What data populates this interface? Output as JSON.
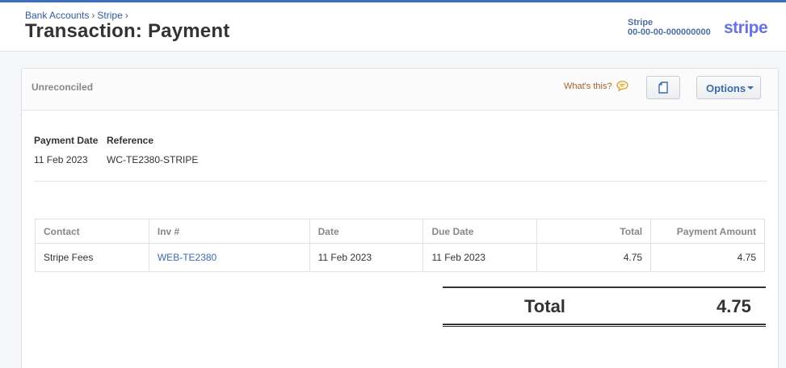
{
  "breadcrumb": {
    "item1": "Bank Accounts",
    "item2": "Stripe",
    "sep": "›"
  },
  "page_title": "Transaction: Payment",
  "account": {
    "name": "Stripe",
    "number": "00-00-00-000000000",
    "logo_text": "stripe"
  },
  "panel": {
    "status": "Unreconciled",
    "whats_this": "What's this?",
    "options_label": "Options",
    "icons": {
      "help": "speech-bubble-icon",
      "copy": "copy-icon",
      "options": "chevron-down-icon"
    }
  },
  "details": {
    "payment_date_label": "Payment Date",
    "payment_date": "11 Feb 2023",
    "reference_label": "Reference",
    "reference": "WC-TE2380-STRIPE"
  },
  "table": {
    "headers": [
      "Contact",
      "Inv #",
      "Date",
      "Due Date",
      "Total",
      "Payment Amount"
    ],
    "rows": [
      [
        "Stripe Fees",
        "WEB-TE2380",
        "11 Feb 2023",
        "11 Feb 2023",
        "4.75",
        "4.75"
      ]
    ]
  },
  "summary": {
    "label": "Total",
    "value": "4.75"
  },
  "colors": {
    "accent": "#3b6fc6",
    "link": "#3a6bb0",
    "stripe": "#6772e5"
  }
}
